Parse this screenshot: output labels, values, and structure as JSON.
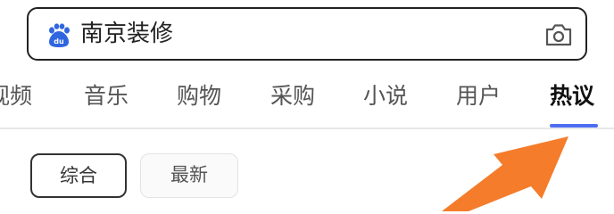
{
  "search": {
    "query": "南京装修",
    "logo_icon": "baidu-paw-icon",
    "camera_icon": "camera-icon"
  },
  "tabs": [
    {
      "label": "视频"
    },
    {
      "label": "音乐"
    },
    {
      "label": "购物"
    },
    {
      "label": "采购"
    },
    {
      "label": "小说"
    },
    {
      "label": "用户"
    },
    {
      "label": "热议"
    }
  ],
  "active_tab": "热议",
  "filters": {
    "comprehensive": "综合",
    "latest": "最新",
    "selected": "综合"
  },
  "colors": {
    "accent": "#4e6ef2",
    "arrow": "#f47c2b",
    "logo": "#2f66e0"
  }
}
